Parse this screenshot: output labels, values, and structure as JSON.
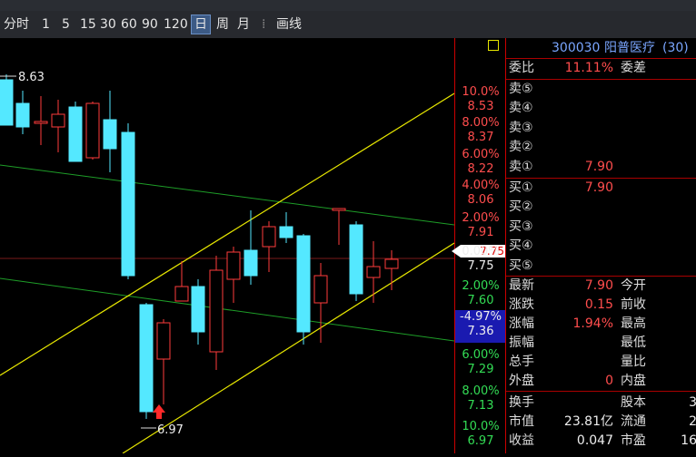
{
  "toolbar": {
    "items": [
      "分时",
      "1",
      "5",
      "15",
      "30",
      "60",
      "90",
      "120",
      "日",
      "周",
      "月"
    ],
    "active": "日",
    "draw_label": "画线"
  },
  "chart": {
    "high_label": "8.63",
    "low_label": "6.97",
    "current_price_tag": "7.75"
  },
  "scale": {
    "items": [
      {
        "pct": "10.0%",
        "price": "8.53",
        "cls": "red"
      },
      {
        "pct": "8.00%",
        "price": "8.37",
        "cls": "red"
      },
      {
        "pct": "6.00%",
        "price": "8.22",
        "cls": "red"
      },
      {
        "pct": "4.00%",
        "price": "8.06",
        "cls": "red"
      },
      {
        "pct": "2.00%",
        "price": "7.91",
        "cls": "red"
      },
      {
        "pct": "0.00%",
        "price": "7.75",
        "cls": "white"
      },
      {
        "pct": "2.00%",
        "price": "7.60",
        "cls": "green"
      },
      {
        "pct": "-4.97%",
        "price": "7.36",
        "cls": "white"
      },
      {
        "pct": "6.00%",
        "price": "7.29",
        "cls": "green"
      },
      {
        "pct": "8.00%",
        "price": "7.13",
        "cls": "green"
      },
      {
        "pct": "10.0%",
        "price": "6.97",
        "cls": "green"
      }
    ]
  },
  "panel": {
    "code": "300030",
    "name": "阳普医疗",
    "suffix": "(30)",
    "weibi_label": "委比",
    "weibi_value": "11.11%",
    "weicha_label": "委差",
    "sell_labels": [
      "卖⑤",
      "卖④",
      "卖③",
      "卖②",
      "卖①"
    ],
    "sell1_price": "7.90",
    "buy_labels": [
      "买①",
      "买②",
      "买③",
      "买④",
      "买⑤"
    ],
    "buy1_price": "7.90",
    "quotes": [
      {
        "l": "最新",
        "v": "7.90",
        "vc": "red",
        "l2": "今开",
        "v2": ""
      },
      {
        "l": "涨跌",
        "v": "0.15",
        "vc": "red",
        "l2": "前收",
        "v2": ""
      },
      {
        "l": "涨幅",
        "v": "1.94%",
        "vc": "red",
        "l2": "最高",
        "v2": ""
      },
      {
        "l": "振幅",
        "v": "",
        "vc": "white",
        "l2": "最低",
        "v2": ""
      },
      {
        "l": "总手",
        "v": "",
        "vc": "white",
        "l2": "量比",
        "v2": ""
      },
      {
        "l": "外盘",
        "v": "0",
        "vc": "red",
        "l2": "内盘",
        "v2": ""
      }
    ],
    "quotes2": [
      {
        "l": "换手",
        "v": "",
        "vc": "white",
        "l2": "股本",
        "v2": "3"
      },
      {
        "l": "市值",
        "v": "23.81亿",
        "vc": "white",
        "l2": "流通",
        "v2": "2"
      },
      {
        "l": "收益",
        "v": "0.047",
        "vc": "white",
        "l2": "市盈",
        "v2": "16"
      }
    ]
  }
}
